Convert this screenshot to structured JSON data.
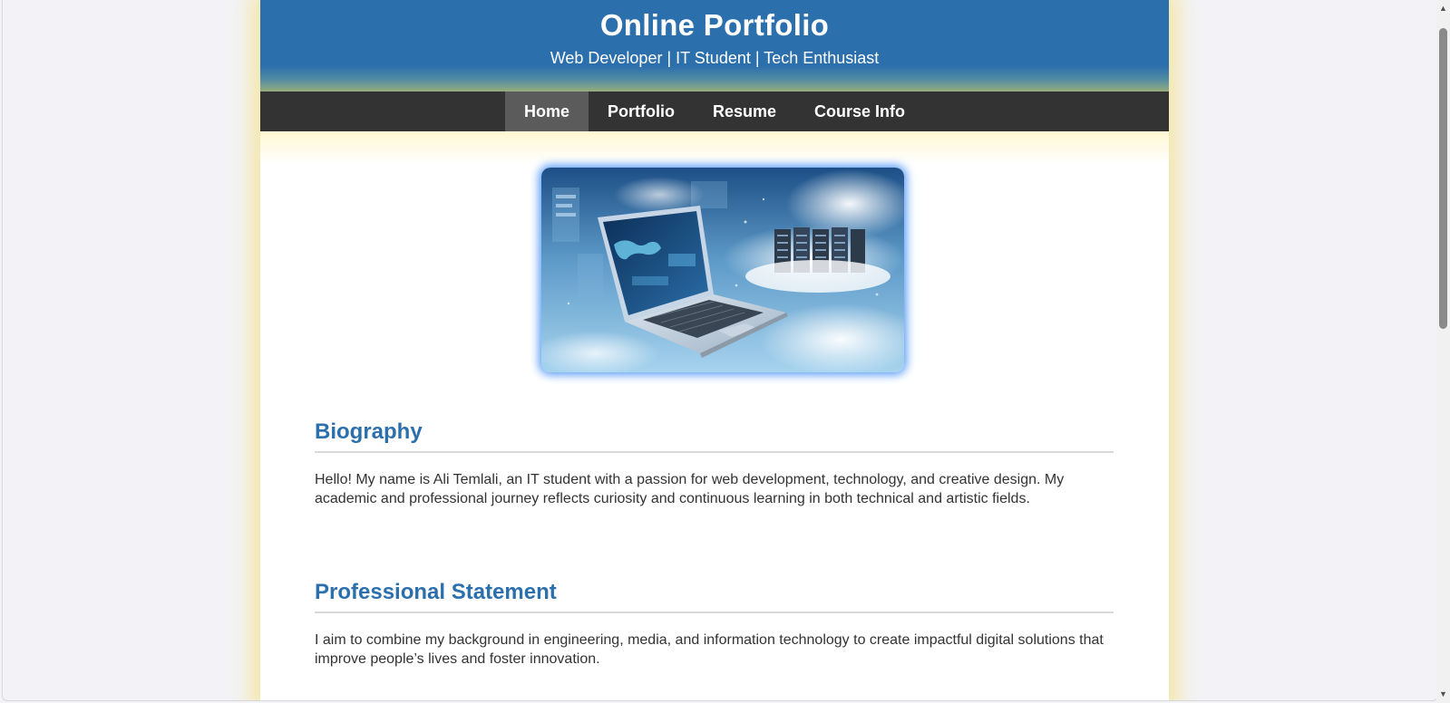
{
  "header": {
    "title": "Online Portfolio",
    "subtitle": "Web Developer | IT Student | Tech Enthusiast"
  },
  "nav": {
    "items": [
      {
        "label": "Home",
        "active": true
      },
      {
        "label": "Portfolio",
        "active": false
      },
      {
        "label": "Resume",
        "active": false
      },
      {
        "label": "Course Info",
        "active": false
      }
    ]
  },
  "hero": {
    "image": "laptop-cloud-computing-illustration"
  },
  "sections": [
    {
      "heading": "Biography",
      "text": "Hello! My name is Ali Temlali, an IT student with a passion for web development, technology, and creative design. My academic and professional journey reflects curiosity and continuous learning in both technical and artistic fields."
    },
    {
      "heading": "Professional Statement",
      "text": "I aim to combine my background in engineering, media, and information technology to create impactful digital solutions that improve people’s lives and foster innovation."
    }
  ],
  "colors": {
    "header_blue": "#2c6fad",
    "nav_bg": "#333333",
    "nav_active": "#5b5b5b",
    "heading": "#2c6fad",
    "page_glow": "#f6e28c"
  }
}
